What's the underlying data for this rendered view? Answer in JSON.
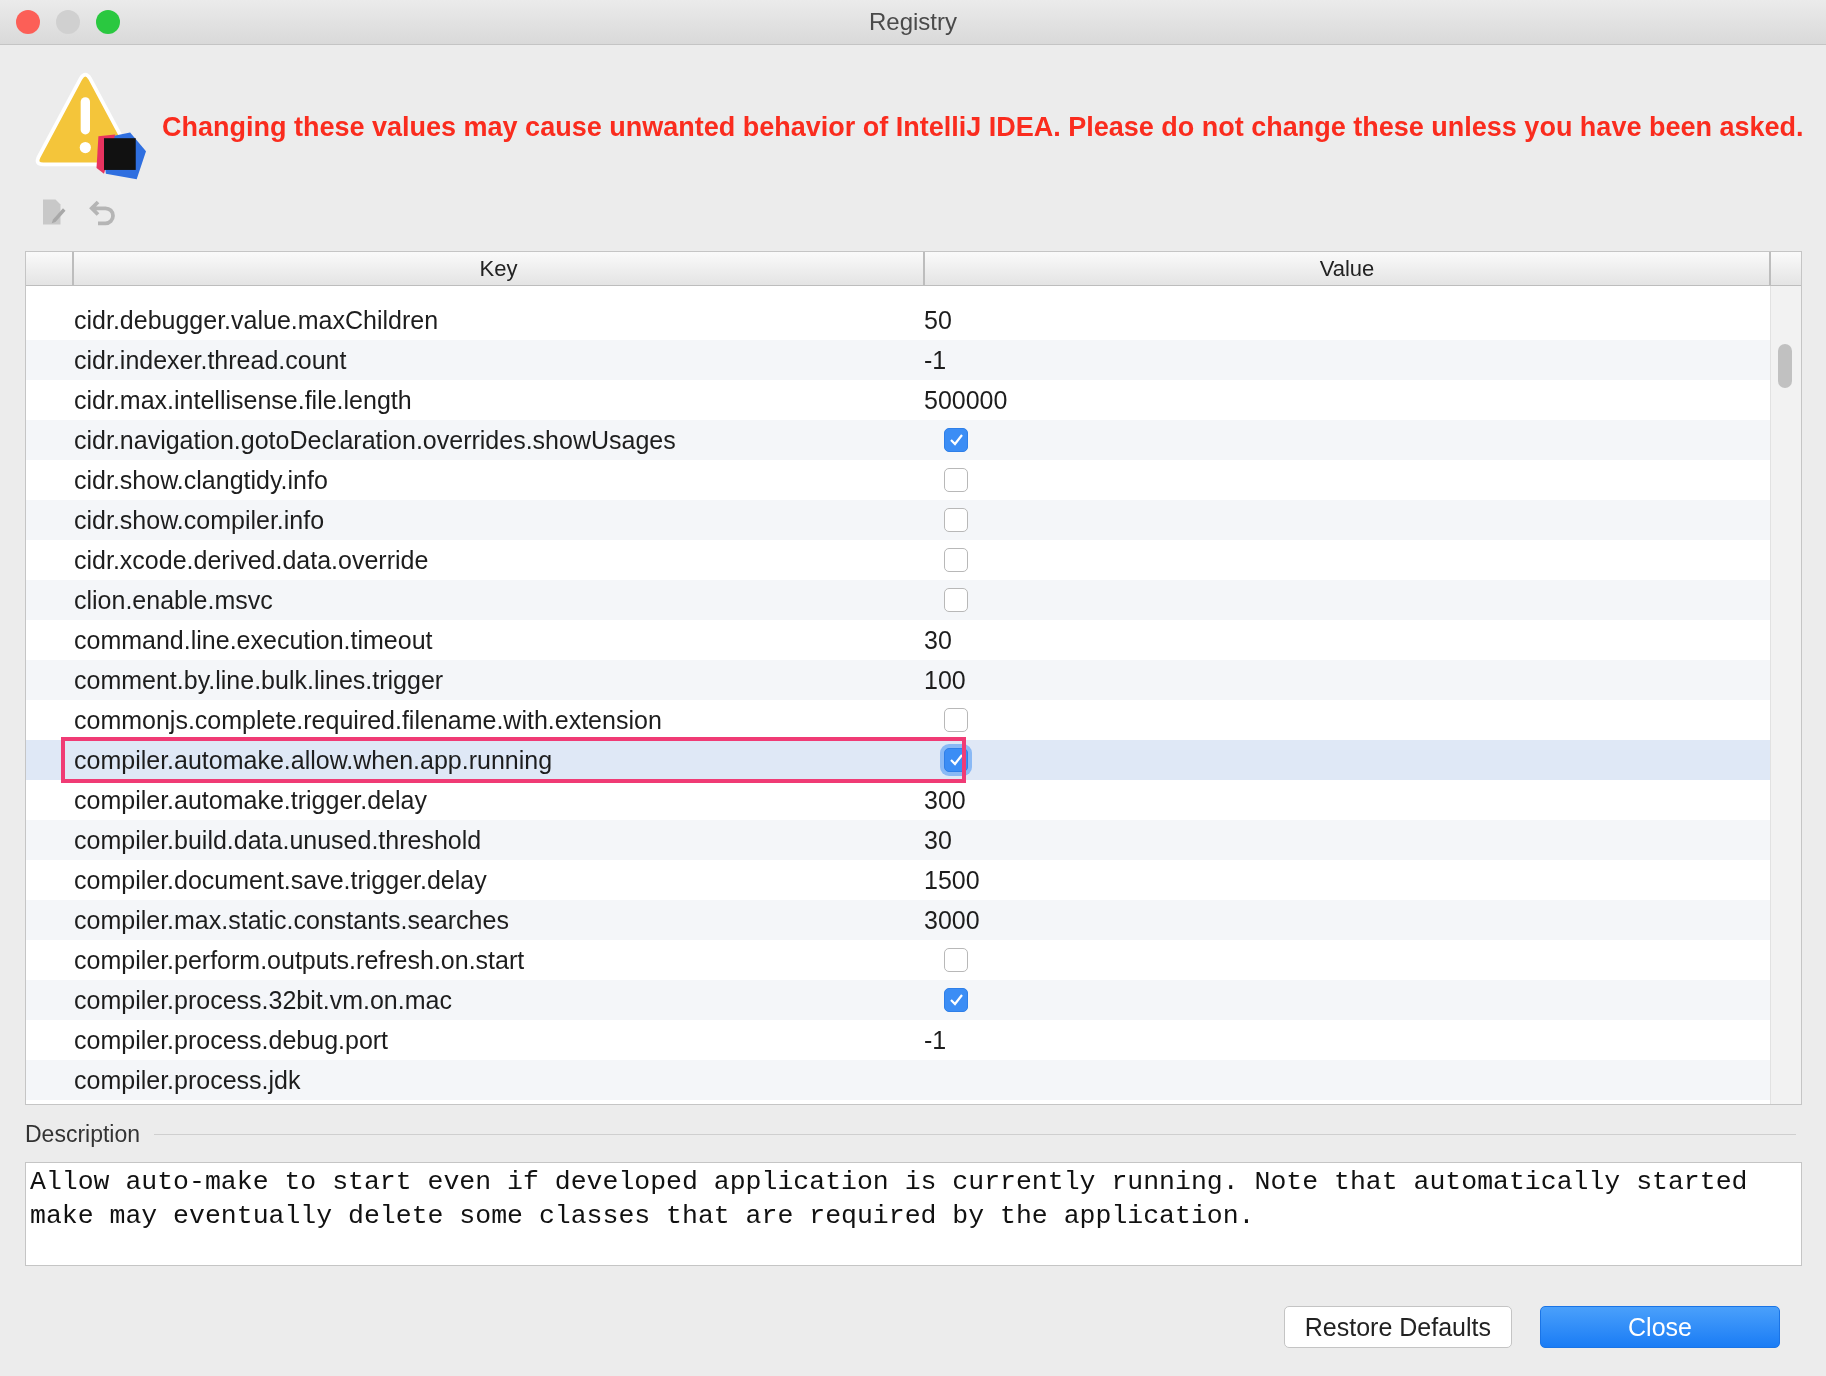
{
  "window": {
    "title": "Registry"
  },
  "warning": "Changing these values may cause unwanted behavior of IntelliJ IDEA. Please do not change these unless you have been asked.",
  "table": {
    "columns": [
      "Key",
      "Value"
    ],
    "rows": [
      {
        "key": "cidr.debugger.value.maxChildren",
        "kind": "text",
        "value": "50",
        "selected": false
      },
      {
        "key": "cidr.indexer.thread.count",
        "kind": "text",
        "value": "-1",
        "selected": false
      },
      {
        "key": "cidr.max.intellisense.file.length",
        "kind": "text",
        "value": "500000",
        "selected": false
      },
      {
        "key": "cidr.navigation.gotoDeclaration.overrides.showUsages",
        "kind": "checkbox",
        "checked": true,
        "selected": false
      },
      {
        "key": "cidr.show.clangtidy.info",
        "kind": "checkbox",
        "checked": false,
        "selected": false
      },
      {
        "key": "cidr.show.compiler.info",
        "kind": "checkbox",
        "checked": false,
        "selected": false
      },
      {
        "key": "cidr.xcode.derived.data.override",
        "kind": "checkbox",
        "checked": false,
        "selected": false
      },
      {
        "key": "clion.enable.msvc",
        "kind": "checkbox",
        "checked": false,
        "selected": false
      },
      {
        "key": "command.line.execution.timeout",
        "kind": "text",
        "value": "30",
        "selected": false
      },
      {
        "key": "comment.by.line.bulk.lines.trigger",
        "kind": "text",
        "value": "100",
        "selected": false
      },
      {
        "key": "commonjs.complete.required.filename.with.extension",
        "kind": "checkbox",
        "checked": false,
        "selected": false
      },
      {
        "key": "compiler.automake.allow.when.app.running",
        "kind": "checkbox",
        "checked": true,
        "selected": true,
        "highlighted": true
      },
      {
        "key": "compiler.automake.trigger.delay",
        "kind": "text",
        "value": "300",
        "selected": false
      },
      {
        "key": "compiler.build.data.unused.threshold",
        "kind": "text",
        "value": "30",
        "selected": false
      },
      {
        "key": "compiler.document.save.trigger.delay",
        "kind": "text",
        "value": "1500",
        "selected": false
      },
      {
        "key": "compiler.max.static.constants.searches",
        "kind": "text",
        "value": "3000",
        "selected": false
      },
      {
        "key": "compiler.perform.outputs.refresh.on.start",
        "kind": "checkbox",
        "checked": false,
        "selected": false
      },
      {
        "key": "compiler.process.32bit.vm.on.mac",
        "kind": "checkbox",
        "checked": true,
        "selected": false
      },
      {
        "key": "compiler.process.debug.port",
        "kind": "text",
        "value": "-1",
        "selected": false
      },
      {
        "key": "compiler.process.jdk",
        "kind": "text",
        "selected": false
      }
    ]
  },
  "description": {
    "label": "Description",
    "text": "Allow auto-make to start even if developed application is currently running. Note that automatically started make may eventually delete some classes that are required by the application."
  },
  "buttons": [
    {
      "label": "Restore Defaults",
      "kind": "secondary"
    },
    {
      "label": "Close",
      "kind": "primary"
    }
  ]
}
